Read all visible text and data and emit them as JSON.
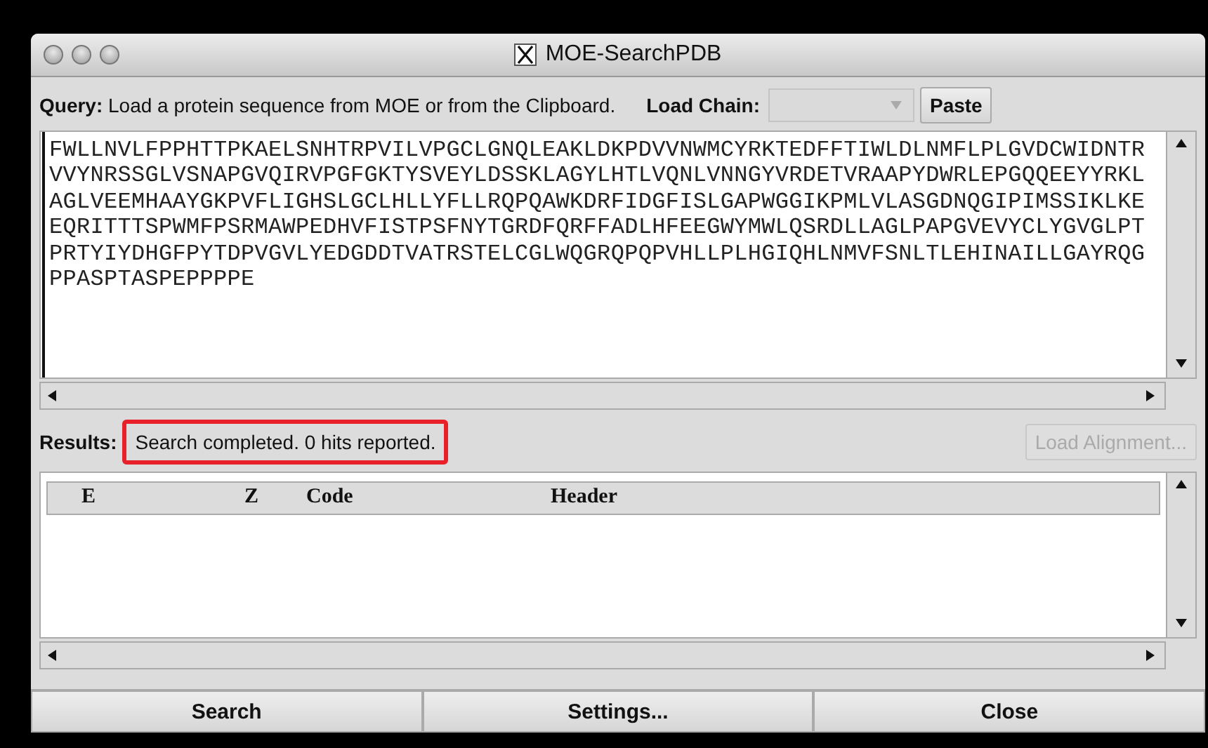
{
  "window": {
    "title": "MOE-SearchPDB"
  },
  "query": {
    "label": "Query:",
    "text": "Load a protein sequence from MOE or from the Clipboard.",
    "chain_label": "Load Chain:",
    "paste_button": "Paste"
  },
  "sequence": [
    "FWLLNVLFPPHTTPKAELSNHTRPVILVPGCLGNQLEAKLDKPDVVNWMCYRKTEDFFTIWLDLNMFLPLGVDCWIDNTR",
    "VVYNRSSGLVSNAPGVQIRVPGFGKTYSVEYLDSSKLAGYLHTLVQNLVNNGYVRDETVRAAPYDWRLEPGQQEEYYRKL",
    "AGLVEEMHAAYGKPVFLIGHSLGCLHLLYFLLRQPQAWKDRFIDGFISLGAPWGGIKPMLVLASGDNQGIPIMSSIKLKE",
    "EQRITTTSPWMFPSRMAWPEDHVFISTPSFNYTGRDFQRFFADLHFEEGWYMWLQSRDLLAGLPAPGVEVYCLYGVGLPT",
    "PRTYIYDHGFPYTDPVGVLYEDGDDTVATRSTELCGLWQGRQPQPVHLLPLHGIQHLNMVFSNLTLEHINAILLGAYRQG",
    "PPASPTASPEPPPPE"
  ],
  "results": {
    "label": "Results:",
    "status": "Search completed. 0 hits reported.",
    "highlighted": true,
    "load_button": {
      "label": "Load Alignment...",
      "disabled": true
    }
  },
  "table": {
    "columns": [
      "E",
      "Z",
      "Code",
      "Header"
    ]
  },
  "buttons": [
    "Search",
    "Settings...",
    "Close"
  ]
}
